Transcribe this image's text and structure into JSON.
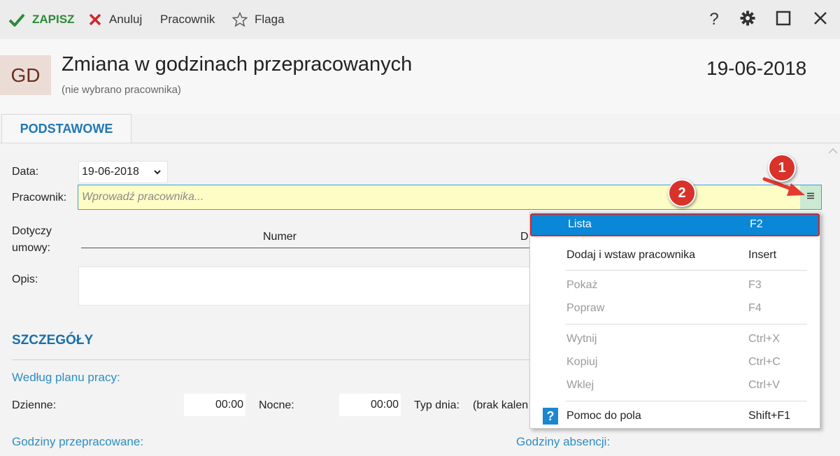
{
  "toolbar": {
    "save": "ZAPISZ",
    "cancel": "Anuluj",
    "worker": "Pracownik",
    "flag": "Flaga"
  },
  "header": {
    "avatar": "GD",
    "title": "Zmiana w godzinach przepracowanych",
    "subtitle": "(nie wybrano pracownika)",
    "date": "19-06-2018"
  },
  "tabs": [
    {
      "label": "PODSTAWOWE"
    }
  ],
  "form": {
    "date_label": "Data:",
    "date_value": "19-06-2018",
    "worker_label": "Pracownik:",
    "worker_placeholder": "Wprowadź pracownika...",
    "contract_label_1": "Dotyczy",
    "contract_label_2": "umowy:",
    "col_number": "Numer",
    "col_d": "D",
    "desc_label": "Opis:"
  },
  "details": {
    "section_title": "SZCZEGÓŁY",
    "plan_label": "Według planu pracy:",
    "day_label": "Dzienne:",
    "day_value": "00:00",
    "night_label": "Nocne:",
    "night_value": "00:00",
    "daytype_label": "Typ dnia:",
    "daytype_value": "(brak kalen",
    "worked_label": "Godziny przepracowane:",
    "absence_label": "Godziny absencji:"
  },
  "context_menu": {
    "items": [
      {
        "label": "Lista",
        "key": "F2"
      },
      {
        "label": "Dodaj i wstaw pracownika",
        "key": "Insert"
      },
      {
        "label": "Pokaż",
        "key": "F3"
      },
      {
        "label": "Popraw",
        "key": "F4"
      },
      {
        "label": "Wytnij",
        "key": "Ctrl+X"
      },
      {
        "label": "Kopiuj",
        "key": "Ctrl+C"
      },
      {
        "label": "Wklej",
        "key": "Ctrl+V"
      },
      {
        "label": "Pomoc do pola",
        "key": "Shift+F1"
      }
    ]
  },
  "annotations": {
    "badge_1": "1",
    "badge_2": "2"
  },
  "colors": {
    "accent_blue": "#1f78b4",
    "save_green": "#2c8a36",
    "cancel_red": "#d4262c",
    "input_yellow": "#fefdc5",
    "selection_blue": "#0a87d7",
    "badge_red": "#d8322a"
  },
  "icons": {
    "save": "checkmark-icon",
    "cancel": "x-icon",
    "flag": "star-icon",
    "help": "question-icon",
    "settings": "gear-icon",
    "maximize": "maximize-icon",
    "close": "close-icon",
    "menu": "hamburger-icon"
  }
}
